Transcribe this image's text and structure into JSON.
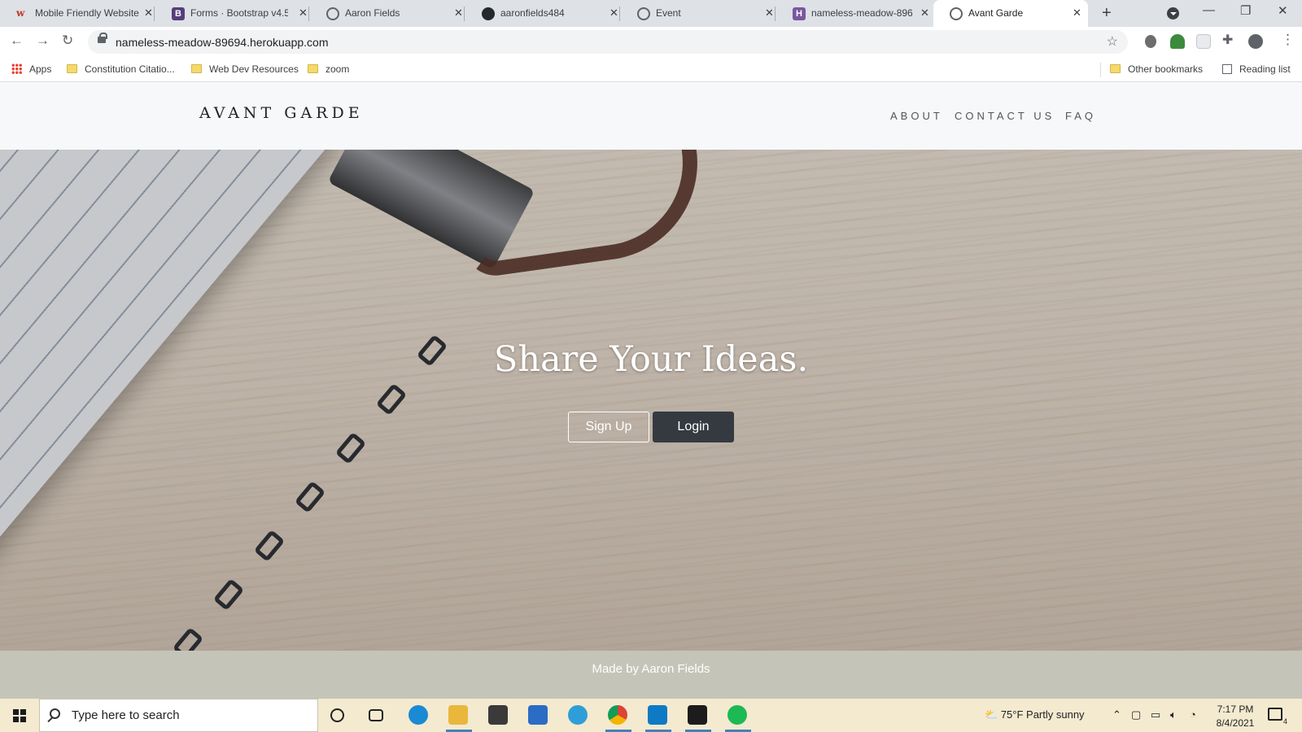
{
  "browser": {
    "tabs": [
      {
        "title": "Mobile Friendly Website",
        "icon": "w3-icon",
        "color": "#c0392b"
      },
      {
        "title": "Forms · Bootstrap v4.5",
        "icon": "bootstrap-icon",
        "color": "#563d7c"
      },
      {
        "title": "Aaron Fields",
        "icon": "globe-icon",
        "color": "#5f6368"
      },
      {
        "title": "aaronfields484",
        "icon": "github-icon",
        "color": "#24292e"
      },
      {
        "title": "Event",
        "icon": "globe-icon",
        "color": "#5f6368"
      },
      {
        "title": "nameless-meadow-896",
        "icon": "heroku-icon",
        "color": "#79589f"
      },
      {
        "title": "Avant Garde",
        "icon": "globe-icon",
        "color": "#5f6368",
        "active": true
      }
    ],
    "url": "nameless-meadow-89694.herokuapp.com",
    "bookmarks": [
      {
        "label": "Apps",
        "icon": "apps-grid-icon"
      },
      {
        "label": "Constitution Citatio...",
        "icon": "folder-icon"
      },
      {
        "label": "Web Dev Resources",
        "icon": "folder-icon"
      },
      {
        "label": "zoom",
        "icon": "folder-icon"
      }
    ],
    "other_bookmarks": "Other bookmarks",
    "reading_list": "Reading list"
  },
  "site": {
    "brand": "AVANT GARDE",
    "nav": [
      "ABOUT",
      "CONTACT US",
      "FAQ"
    ],
    "headline": "Share Your Ideas.",
    "signup_label": "Sign Up",
    "login_label": "Login",
    "footer": "Made by Aaron Fields"
  },
  "taskbar": {
    "search_placeholder": "Type here to search",
    "weather": "75°F  Partly sunny",
    "time": "7:17 PM",
    "date": "8/4/2021",
    "notification_count": "4"
  },
  "colors": {
    "login_button": "#343a40",
    "footer": "#c4c4b8",
    "taskbar": "#f3ead0"
  }
}
